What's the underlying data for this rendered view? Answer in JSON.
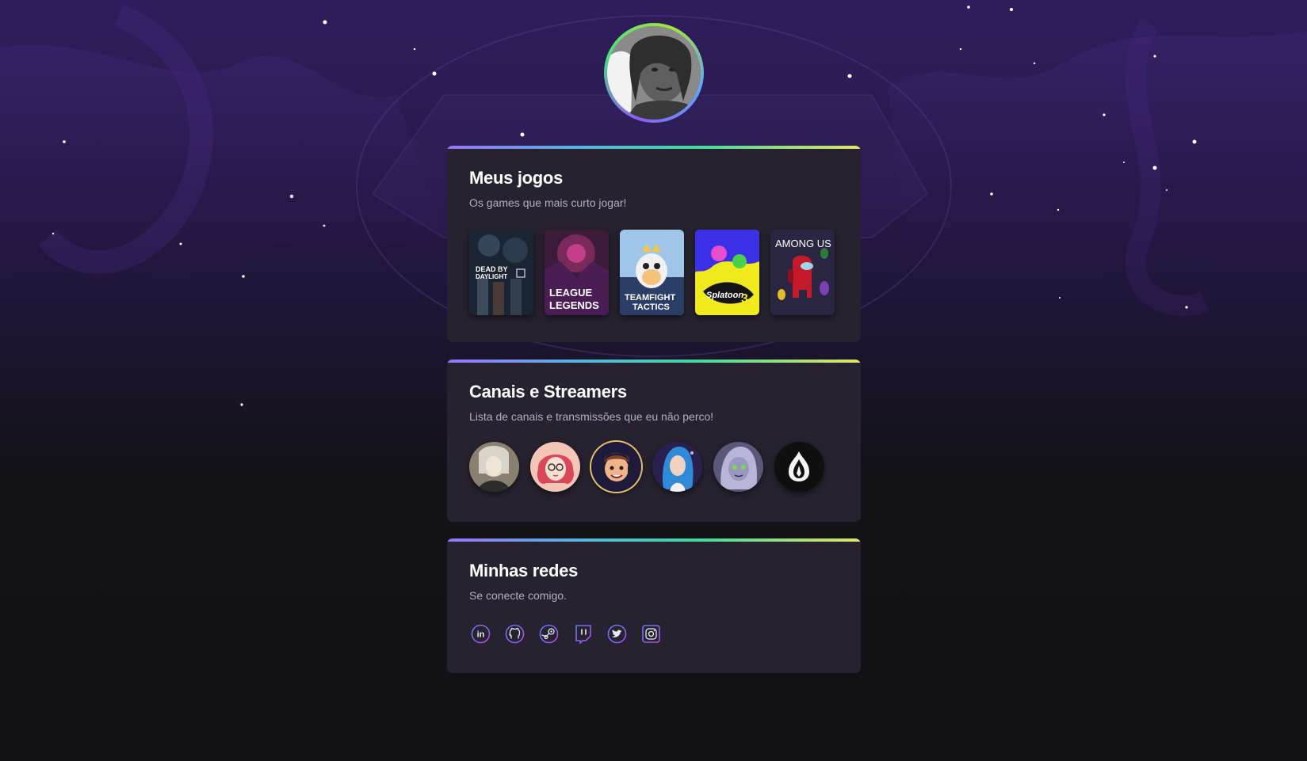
{
  "profile": {
    "avatar_alt": "profile-photo"
  },
  "games_card": {
    "title": "Meus jogos",
    "subtitle": "Os games que mais curto jogar!",
    "games": [
      {
        "name": "Dead by Daylight",
        "line1": "DEAD BY",
        "line2": "DAYLIGHT"
      },
      {
        "name": "League of Legends",
        "line1": "LEAGUE",
        "line2": "LEGENDS"
      },
      {
        "name": "Teamfight Tactics",
        "line1": "TEAMFIGHT",
        "line2": "TACTICS"
      },
      {
        "name": "Splatoon 3",
        "line1": "Splatoon",
        "line2": "3"
      },
      {
        "name": "Among Us",
        "line1": "AMONG US",
        "line2": ""
      }
    ]
  },
  "channels_card": {
    "title": "Canais e Streamers",
    "subtitle": "Lista de canais e transmissões que eu não perco!",
    "channels": [
      {
        "name": "channel-1",
        "color": "#8a8070"
      },
      {
        "name": "channel-2",
        "color": "#f2b8a8"
      },
      {
        "name": "channel-3",
        "color": "#1e1a3c"
      },
      {
        "name": "channel-4",
        "color": "#4a3a7a"
      },
      {
        "name": "channel-5",
        "color": "#7a7898"
      },
      {
        "name": "channel-6",
        "color": "#0f0f10"
      }
    ]
  },
  "socials_card": {
    "title": "Minhas redes",
    "subtitle": "Se conecte comigo.",
    "links": [
      {
        "name": "linkedin-icon",
        "glyph": "in"
      },
      {
        "name": "github-icon",
        "glyph": ""
      },
      {
        "name": "steam-icon",
        "glyph": ""
      },
      {
        "name": "twitch-icon",
        "glyph": ""
      },
      {
        "name": "twitter-icon",
        "glyph": ""
      },
      {
        "name": "instagram-icon",
        "glyph": ""
      }
    ]
  },
  "colors": {
    "accent_purple": "#8b5cf6",
    "accent_green": "#3fd9a0",
    "accent_yellow": "#e3e364",
    "card_bg": "#26222f",
    "page_bg_top": "#2e1d5c",
    "page_bg_bottom": "#121115"
  }
}
